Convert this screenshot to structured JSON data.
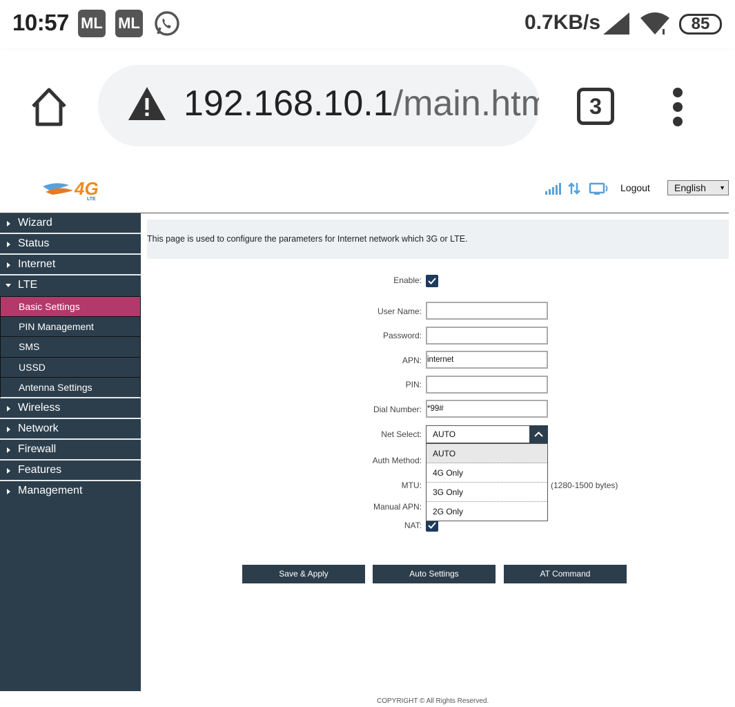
{
  "status_bar": {
    "time": "10:57",
    "app_icons": [
      "ML",
      "ML"
    ],
    "whatsapp_icon": "whatsapp-icon",
    "speed": "0.7KB/s",
    "battery": "85"
  },
  "browser": {
    "url_host": "192.168.10.1",
    "url_path": "/main.htm",
    "tab_count": "3"
  },
  "header": {
    "logo_text": "4G",
    "logo_sub": "LTE",
    "logout": "Logout",
    "language": "English"
  },
  "sidebar": {
    "items": [
      {
        "label": "Wizard"
      },
      {
        "label": "Status"
      },
      {
        "label": "Internet"
      },
      {
        "label": "LTE"
      },
      {
        "label": "Wireless"
      },
      {
        "label": "Network"
      },
      {
        "label": "Firewall"
      },
      {
        "label": "Features"
      },
      {
        "label": "Management"
      }
    ],
    "lte_sub": [
      {
        "label": "Basic Settings"
      },
      {
        "label": "PIN Management"
      },
      {
        "label": "SMS"
      },
      {
        "label": "USSD"
      },
      {
        "label": "Antenna Settings"
      }
    ]
  },
  "content": {
    "description": "This page is used to configure the parameters for Internet network which 3G or LTE.",
    "labels": {
      "enable": "Enable:",
      "user_name": "User Name:",
      "password": "Password:",
      "apn": "APN:",
      "pin": "PIN:",
      "dial_number": "Dial Number:",
      "net_select": "Net Select:",
      "auth_method": "Auth Method:",
      "mtu": "MTU:",
      "manual_apn": "Manual APN:",
      "nat": "NAT:"
    },
    "values": {
      "user_name": "",
      "password": "",
      "apn": "internet",
      "pin": "",
      "dial_number": "*99#",
      "net_select": "AUTO"
    },
    "net_options": [
      "AUTO",
      "4G Only",
      "3G Only",
      "2G Only"
    ],
    "mtu_hint": "(1280-1500 bytes)",
    "buttons": {
      "save": "Save & Apply",
      "auto": "Auto Settings",
      "at": "AT Command"
    },
    "copyright": "COPYRIGHT © All Rights Reserved."
  }
}
